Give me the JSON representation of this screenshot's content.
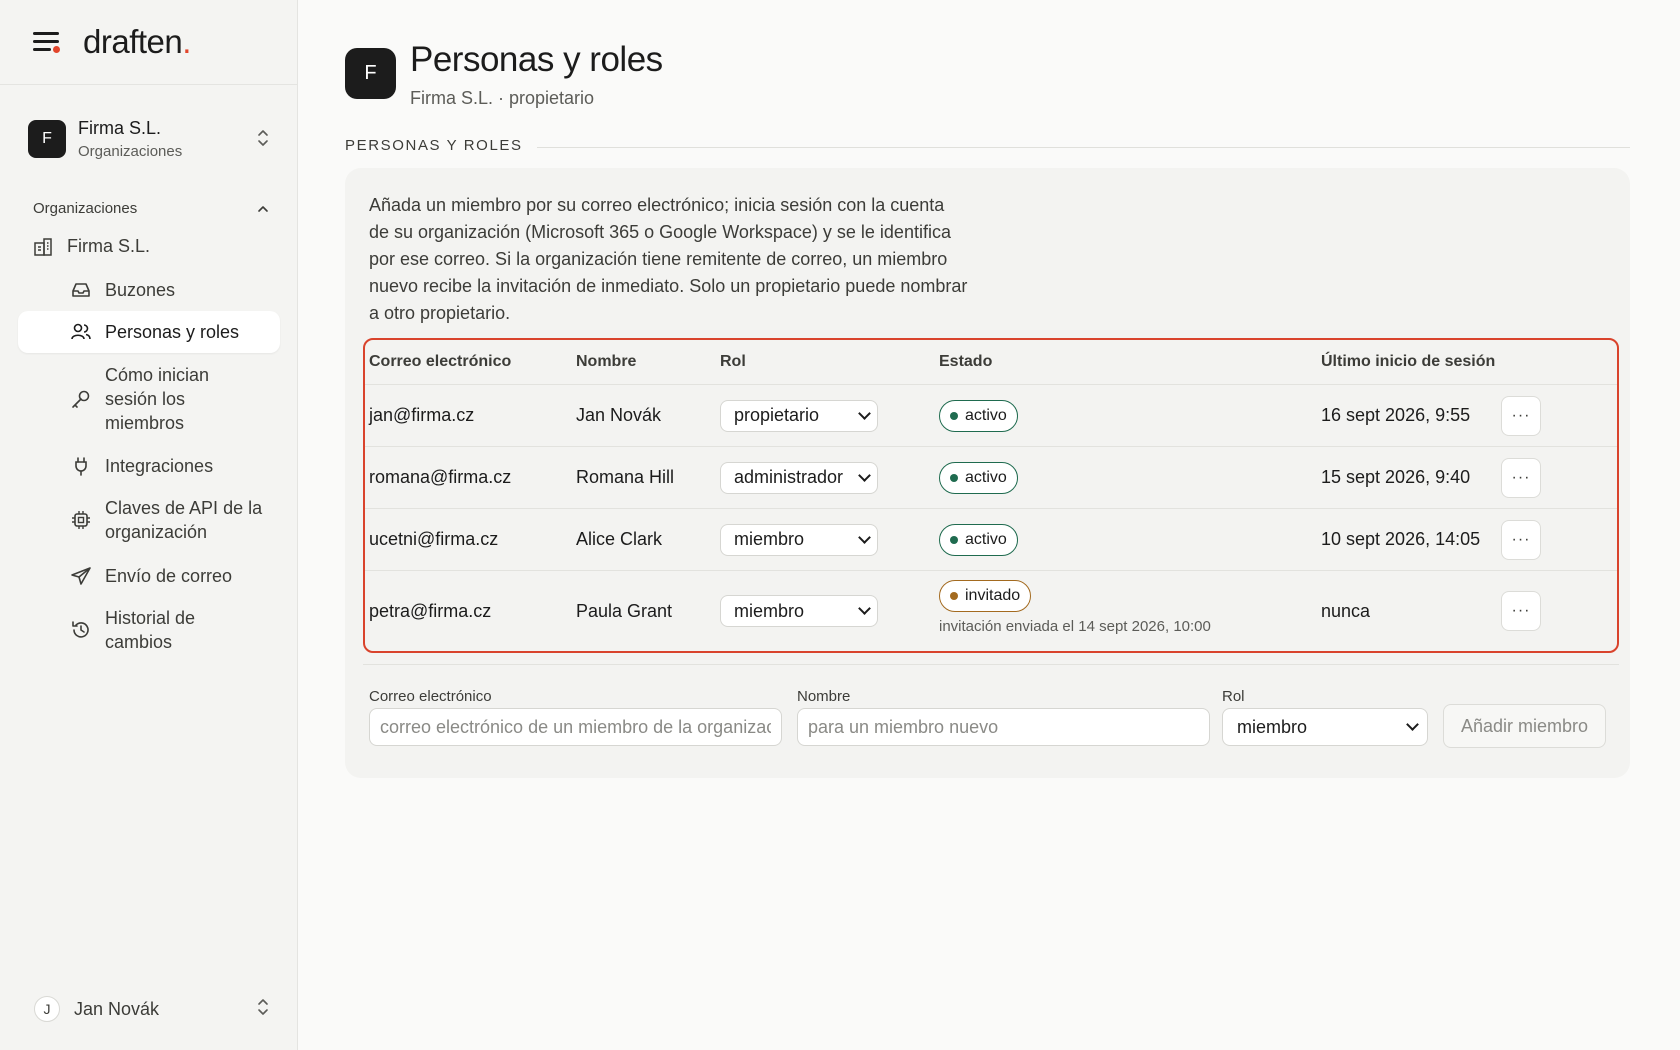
{
  "brand": {
    "wordmark": "draften",
    "dot": "."
  },
  "org_switcher": {
    "avatar": "F",
    "name": "Firma S.L.",
    "subtitle": "Organizaciones"
  },
  "sidebar": {
    "section_title": "Organizaciones",
    "org_item": "Firma S.L.",
    "items": [
      {
        "label": "Buzones",
        "icon": "inbox-icon"
      },
      {
        "label": "Personas y roles",
        "icon": "users-icon",
        "active": true
      },
      {
        "label": "Cómo inician sesión los miembros",
        "icon": "key-icon"
      },
      {
        "label": "Integraciones",
        "icon": "plug-icon"
      },
      {
        "label": "Claves de API de la organización",
        "icon": "chip-icon"
      },
      {
        "label": "Envío de correo",
        "icon": "send-icon"
      },
      {
        "label": "Historial de cambios",
        "icon": "history-icon"
      }
    ]
  },
  "user": {
    "avatar": "J",
    "name": "Jan Novák"
  },
  "page": {
    "avatar": "F",
    "title": "Personas y roles",
    "subtitle": "Firma S.L. · propietario",
    "section_label": "PERSONAS Y ROLES",
    "intro": "Añada un miembro por su correo electrónico; inicia sesión con la cuenta de su organización (Microsoft 365 o Google Workspace) y se le identifica por ese correo. Si la organización tiene remitente de correo, un miembro nuevo recibe la invitación de inmediato. Solo un propietario puede nombrar a otro propietario."
  },
  "table": {
    "headers": {
      "email": "Correo electrónico",
      "name": "Nombre",
      "role": "Rol",
      "state": "Estado",
      "last_login": "Último inicio de sesión"
    },
    "rows": [
      {
        "email": "jan@firma.cz",
        "name": "Jan Novák",
        "role": "propietario",
        "state": "activo",
        "last_login": "16 sept 2026, 9:55"
      },
      {
        "email": "romana@firma.cz",
        "name": "Romana Hill",
        "role": "administrador",
        "state": "activo",
        "last_login": "15 sept 2026, 9:40"
      },
      {
        "email": "ucetni@firma.cz",
        "name": "Alice Clark",
        "role": "miembro",
        "state": "activo",
        "last_login": "10 sept 2026, 14:05"
      },
      {
        "email": "petra@firma.cz",
        "name": "Paula Grant",
        "role": "miembro",
        "state": "invitado",
        "note": "invitación enviada el 14 sept 2026, 10:00",
        "last_login": "nunca"
      }
    ],
    "more_label": "···"
  },
  "form": {
    "email_label": "Correo electrónico",
    "email_placeholder": "correo electrónico de un miembro de la organización",
    "name_label": "Nombre",
    "name_placeholder": "para un miembro nuevo",
    "role_label": "Rol",
    "role_value": "miembro",
    "submit_label": "Añadir miembro"
  },
  "colors": {
    "accent": "#e2452b",
    "active_badge": "#1f6b4f",
    "invited_badge": "#a36a1f",
    "highlight": "#d9432c"
  }
}
